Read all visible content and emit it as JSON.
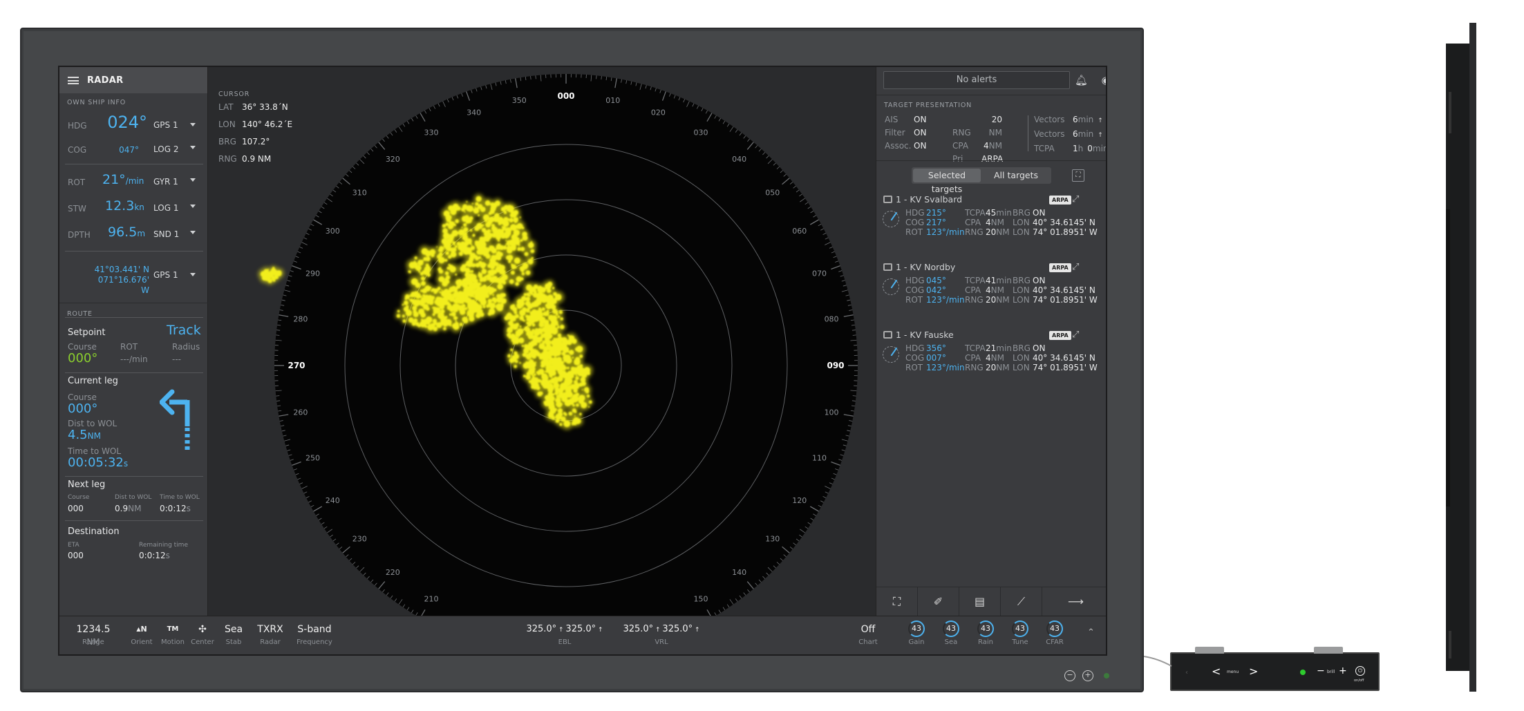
{
  "app": {
    "title": "RADAR"
  },
  "own_ship": {
    "section": "OWN SHIP INFO",
    "hdg": {
      "label": "HDG",
      "value": "024°",
      "source": "GPS 1"
    },
    "cog": {
      "label": "COG",
      "value": "047°",
      "source": "LOG 2"
    },
    "rot": {
      "label": "ROT",
      "value": "21°",
      "unit": "/min",
      "source": "GYR 1"
    },
    "stw": {
      "label": "STW",
      "value": "12.3",
      "unit": "kn",
      "source": "LOG 1"
    },
    "dpth": {
      "label": "DPTH",
      "value": "96.5",
      "unit": "m",
      "source": "SND 1"
    },
    "pos": {
      "lat": "41°03.441' N",
      "lon": "071°16.676' W",
      "source": "GPS 1"
    }
  },
  "route": {
    "section": "ROUTE",
    "setpoint": {
      "label": "Setpoint",
      "mode": "Track",
      "course_label": "Course",
      "course": "000°",
      "rot_label": "ROT",
      "rot": "---/min",
      "radius_label": "Radius",
      "radius": "---"
    },
    "current_leg": {
      "label": "Current leg",
      "course_label": "Course",
      "course": "000°",
      "dist_label": "Dist to WOL",
      "dist": "4.5",
      "dist_unit": "NM",
      "time_label": "Time to WOL",
      "time": "00:05:32",
      "time_unit": "s"
    },
    "next_leg": {
      "label": "Next leg",
      "course_label": "Course",
      "course": "000",
      "dist_label": "Dist to WOL",
      "dist": "0.9",
      "dist_unit": "NM",
      "time_label": "Time to WOL",
      "time": "0:0:12",
      "time_unit": "s"
    },
    "destination": {
      "label": "Destination",
      "eta_label": "ETA",
      "eta": "000",
      "remain_label": "Remaining time",
      "remain": "0:0:12",
      "remain_unit": "s"
    }
  },
  "cursor": {
    "section": "CURSOR",
    "lat_label": "LAT",
    "lat": "36° 33.8´N",
    "lon_label": "LON",
    "lon": "140° 46.2´E",
    "brg_label": "BRG",
    "brg": "107.2°",
    "rng_label": "RNG",
    "rng": "0.9 NM"
  },
  "bearing_scale": [
    "000",
    "010",
    "020",
    "030",
    "040",
    "050",
    "060",
    "070",
    "080",
    "090",
    "100",
    "110",
    "120",
    "130",
    "140",
    "150",
    "160",
    "170",
    "180",
    "190",
    "200",
    "210",
    "220",
    "230",
    "240",
    "250",
    "260",
    "270",
    "280",
    "290",
    "300",
    "310",
    "320",
    "330",
    "340",
    "350"
  ],
  "alerts": {
    "text": "No alerts"
  },
  "target_presentation": {
    "section": "TARGET PRESENTATION",
    "ais": {
      "label": "AIS",
      "value": "ON"
    },
    "filter": {
      "label": "Filter",
      "value": "ON"
    },
    "assoc": {
      "label": "Assoc.",
      "value": "ON"
    },
    "rng": {
      "label": "RNG",
      "value": "20",
      "unit": "NM"
    },
    "cpa": {
      "label": "CPA",
      "value": "4",
      "unit": "NM"
    },
    "pri": {
      "label": "Pri",
      "value": "ARPA"
    },
    "vectors1": {
      "label": "Vectors",
      "value": "6",
      "unit": "min"
    },
    "vectors2": {
      "label": "Vectors",
      "value": "6",
      "unit": "min"
    },
    "tcpa": {
      "label": "TCPA",
      "h": "1",
      "h_unit": "h",
      "m": "0",
      "m_unit": "min"
    }
  },
  "tabs": {
    "selected": "Selected targets",
    "all": "All targets"
  },
  "targets": [
    {
      "name": "1 - KV Svalbard",
      "tag": "ARPA",
      "hdg": "215°",
      "cog": "217°",
      "rot": "123°",
      "rot_unit": "/min",
      "tcpa": "45",
      "tcpa_unit": "min",
      "cpa": "4",
      "cpa_unit": "NM",
      "rng": "20",
      "rng_unit": "NM",
      "brg": "ON",
      "lat": "40° 34.6145' N",
      "lon": "74° 01.8951' W"
    },
    {
      "name": "1 - KV Nordby",
      "tag": "ARPA",
      "hdg": "045°",
      "cog": "042°",
      "rot": "123°",
      "rot_unit": "/min",
      "tcpa": "41",
      "tcpa_unit": "min",
      "cpa": "4",
      "cpa_unit": "NM",
      "rng": "20",
      "rng_unit": "NM",
      "brg": "ON",
      "lat": "40° 34.6145' N",
      "lon": "74° 01.8951' W"
    },
    {
      "name": "1 - KV Fauske",
      "tag": "ARPA",
      "hdg": "356°",
      "cog": "007°",
      "rot": "123°",
      "rot_unit": "/min",
      "tcpa": "21",
      "tcpa_unit": "min",
      "cpa": "4",
      "cpa_unit": "NM",
      "rng": "20",
      "rng_unit": "NM",
      "brg": "ON",
      "lat": "40° 34.6145' N",
      "lon": "74° 01.8951' W"
    }
  ],
  "target_labels": {
    "hdg": "HDG",
    "cog": "COG",
    "rot": "ROT",
    "tcpa": "TCPA",
    "cpa": "CPA",
    "rng": "RNG",
    "brg": "BRG",
    "lon": "LON"
  },
  "bottom_bar": {
    "range": {
      "value": "1234.5",
      "unit": "NM",
      "label": "Range"
    },
    "orient": {
      "value": "N",
      "label": "Orient"
    },
    "motion": {
      "value": "TM",
      "label": "Motion"
    },
    "center": {
      "label": "Center"
    },
    "stab": {
      "value": "Sea",
      "label": "Stab"
    },
    "radar": {
      "value": "TXRX",
      "label": "Radar"
    },
    "frequency": {
      "value": "S-band",
      "label": "Frequency"
    },
    "ebl": {
      "v1": "325.0°",
      "v2": "325.0°",
      "label": "EBL"
    },
    "vrl": {
      "v1": "325.0°",
      "v2": "325.0°",
      "label": "VRL"
    },
    "chart": {
      "value": "Off",
      "label": "Chart"
    },
    "gain": {
      "value": "43",
      "label": "Gain"
    },
    "sea": {
      "value": "43",
      "label": "Sea"
    },
    "rain": {
      "value": "43",
      "label": "Rain"
    },
    "tune": {
      "value": "43",
      "label": "Tune"
    },
    "cfar": {
      "value": "43",
      "label": "CFAR"
    }
  },
  "controller": {
    "menu": "menu",
    "brill": "brill",
    "onoff": "on/off"
  },
  "colors": {
    "accent": "#4db3f0",
    "echo": "#f2ee1a",
    "setpoint": "#8bcf2e"
  }
}
